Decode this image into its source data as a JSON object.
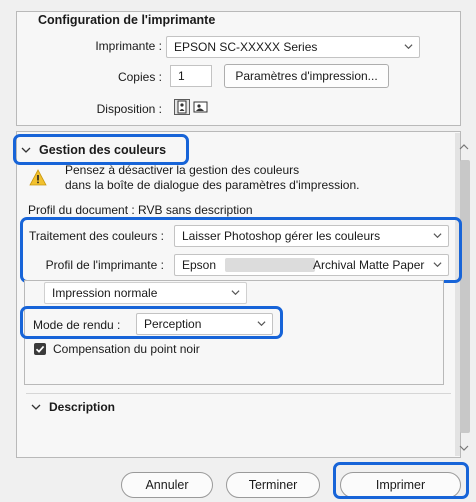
{
  "printer_setup": {
    "title": "Configuration de l'imprimante",
    "printer_label": "Imprimante :",
    "printer_value": "EPSON SC-XXXXX Series",
    "copies_label": "Copies :",
    "copies_value": "1",
    "print_settings_button": "Paramètres d'impression...",
    "layout_label": "Disposition :"
  },
  "color_management": {
    "title": "Gestion des couleurs",
    "warning_line1": "Pensez à désactiver la gestion des couleurs",
    "warning_line2": "dans la boîte de dialogue des paramètres d'impression.",
    "document_profile": "Profil du document : RVB sans description",
    "color_handling_label": "Traitement des couleurs :",
    "color_handling_value": "Laisser Photoshop gérer les couleurs",
    "printer_profile_label": "Profil de l'imprimante :",
    "printer_profile_prefix": "Epson",
    "printer_profile_suffix": "Archival Matte Paper",
    "print_mode_value": "Impression normale",
    "rendering_intent_label": "Mode de rendu :",
    "rendering_intent_value": "Perception",
    "black_point_label": "Compensation du point noir",
    "black_point_checked": true
  },
  "description": {
    "title": "Description"
  },
  "footer": {
    "cancel_button": "Annuler",
    "done_button": "Terminer",
    "print_button": "Imprimer"
  },
  "colors": {
    "highlight": "#1764d8",
    "warning": "#f2c12e"
  }
}
